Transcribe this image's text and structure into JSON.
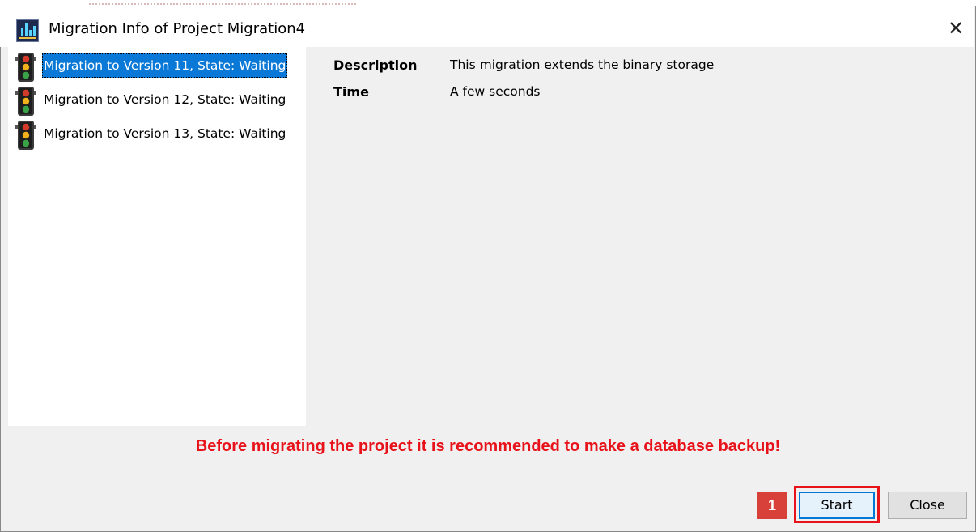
{
  "dialog": {
    "title": "Migration Info of Project Migration4",
    "close_glyph": "✕"
  },
  "migrations": [
    {
      "label": "Migration to Version 11, State: Waiting",
      "selected": true,
      "icon": "traffic-light-icon"
    },
    {
      "label": "Migration to Version 12, State: Waiting",
      "selected": false,
      "icon": "traffic-light-icon"
    },
    {
      "label": "Migration to Version 13, State: Waiting",
      "selected": false,
      "icon": "traffic-light-icon"
    }
  ],
  "details": {
    "description_label": "Description",
    "description_value": "This migration extends the binary storage",
    "time_label": "Time",
    "time_value": "A few seconds"
  },
  "warning": "Before migrating the project it is recommended to make a database backup!",
  "annotation": {
    "badge": "1"
  },
  "buttons": {
    "start": "Start",
    "close": "Close"
  },
  "colors": {
    "selection": "#0a78d7",
    "warning": "#e8131a",
    "badge": "#d8403a"
  }
}
